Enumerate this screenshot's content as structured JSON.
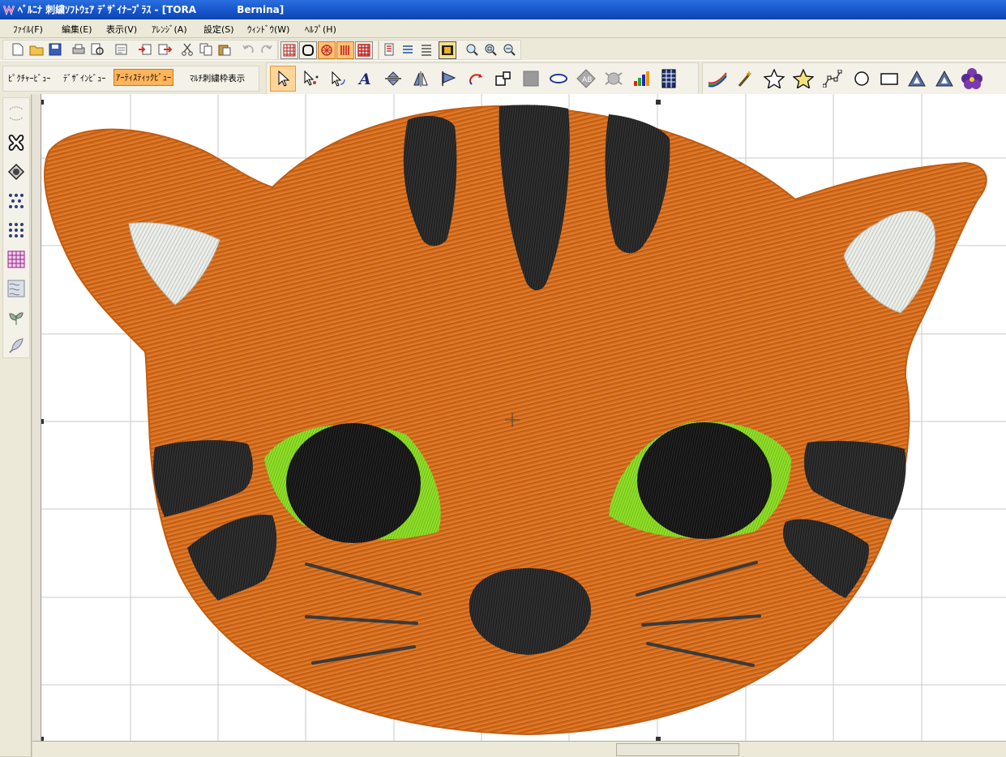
{
  "window": {
    "title": "ﾍﾞﾙﾆﾅ 刺繍ｿﾌﾄｳｪｱ ﾃﾞｻﾞｲﾅｰﾌﾟﾗｽ - [TORA            Bernina]"
  },
  "menu": [
    {
      "label": "ﾌｧｲﾙ(F)"
    },
    {
      "label": "編集(E)"
    },
    {
      "label": "表示(V)"
    },
    {
      "label": "ｱﾚﾝｼﾞ(A)"
    },
    {
      "label": "設定(S)"
    },
    {
      "label": "ｳｨﾝﾄﾞｳ(W)"
    },
    {
      "label": "ﾍﾙﾌﾟ(H)"
    }
  ],
  "views": [
    {
      "label": "ﾋﾟｸﾁｬｰﾋﾞｭｰ"
    },
    {
      "label": "ﾃﾞｻﾞｲﾝﾋﾞｭｰ"
    },
    {
      "label": "ｱｰﾃｨｽﾃｨｯｸﾋﾞｭｰ",
      "active": true
    },
    {
      "label": "ﾏﾙﾁ刺繍枠表示"
    }
  ],
  "toolbar": {
    "file_icons": [
      "new-icon",
      "open-icon",
      "save-icon",
      "print-icon",
      "print-preview-icon",
      "properties-icon",
      "import-icon",
      "export-icon",
      "cut-icon",
      "copy-icon",
      "paste-icon",
      "undo-icon",
      "redo-icon"
    ],
    "display_icons": [
      "grid-icon",
      "hoop-icon",
      "stitch-view-icon",
      "artistic-view-icon",
      "fabric-grid-icon"
    ],
    "palette_icons": [
      "color-film-icon",
      "stitch-player-icon",
      "sequence-icon",
      "slow-redraw-icon"
    ],
    "zoom_icons": [
      "zoom-in-icon",
      "zoom-fit-icon",
      "zoom-out-icon"
    ]
  },
  "tools": [
    "select-arrow-icon",
    "point-select-icon",
    "reshape-icon",
    "lettering-icon",
    "align-icon",
    "mirror-icon",
    "flag-icon",
    "rotate-icon",
    "group-icon",
    "fill-icon",
    "ellipse-outline-icon",
    "monogram-icon",
    "auto-digitize-icon",
    "color-sort-icon",
    "grid-pattern-icon"
  ],
  "tools2": [
    "brush-icon",
    "magic-wand-icon",
    "star-outline-icon",
    "star-filled-icon",
    "polygon-icon",
    "circle-icon",
    "rectangle-icon",
    "triangle-icon",
    "triangle-alt-icon",
    "motif-flower-icon"
  ],
  "side_tools": [
    "outline-icon",
    "cross-stitch-icon",
    "satin-icon",
    "dots-icon",
    "dots-grid-icon",
    "pattern-fill-icon",
    "texture-fill-icon",
    "leaf-icon",
    "feather-icon"
  ],
  "design": {
    "name": "TORA",
    "colors": {
      "body": "#d9701e",
      "stripe": "#2e2e2e",
      "ear": "#e8ebe6",
      "eye_ring": "#8fe028",
      "pupil": "#111111",
      "nose": "#262626",
      "whisker": "#3a3a3a"
    }
  },
  "colors": {
    "title_bar": "#1553c9",
    "toolbar_bg": "#ece9d8",
    "active_view": "#ffb45a"
  }
}
